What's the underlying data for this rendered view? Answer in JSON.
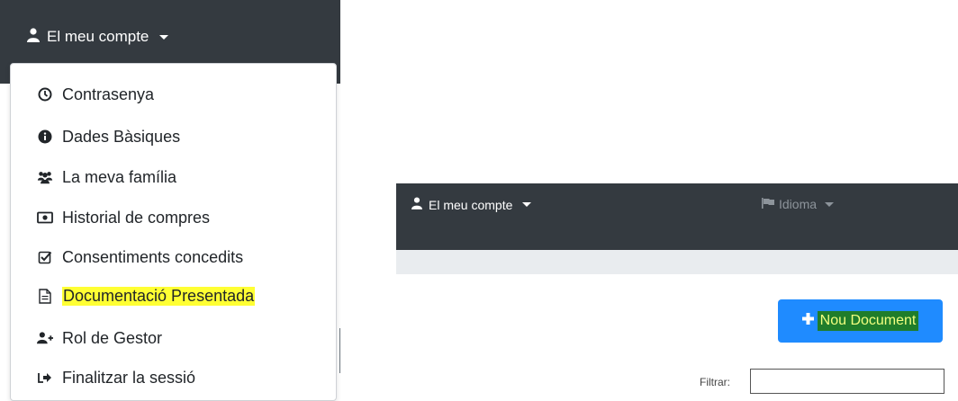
{
  "left_panel": {
    "account_label": "El meu compte",
    "menu_items": [
      {
        "label": "Contrasenya",
        "icon": "clock-icon"
      },
      {
        "label": "Dades Bàsiques",
        "icon": "info-circle-icon"
      },
      {
        "label": "La meva família",
        "icon": "users-icon"
      },
      {
        "label": "Historial de compres",
        "icon": "money-icon"
      },
      {
        "label": "Consentiments concedits",
        "icon": "checkbox-icon"
      },
      {
        "label": "Documentació Presentada",
        "icon": "file-text-icon",
        "highlighted": true
      },
      {
        "label": "Rol de Gestor",
        "icon": "user-plus-icon"
      },
      {
        "label": "Finalitzar la sessió",
        "icon": "sign-out-icon"
      }
    ]
  },
  "right_panel": {
    "account_label": "El meu compte",
    "language_label": "Idioma",
    "new_document_label": "Nou Document",
    "filter_label": "Filtrar:",
    "filter_value": ""
  },
  "colors": {
    "navbar": "#343a40",
    "primary_button": "#1f8bff",
    "highlight_yellow": "#ffff33",
    "highlight_green": "#1f7d2b"
  }
}
